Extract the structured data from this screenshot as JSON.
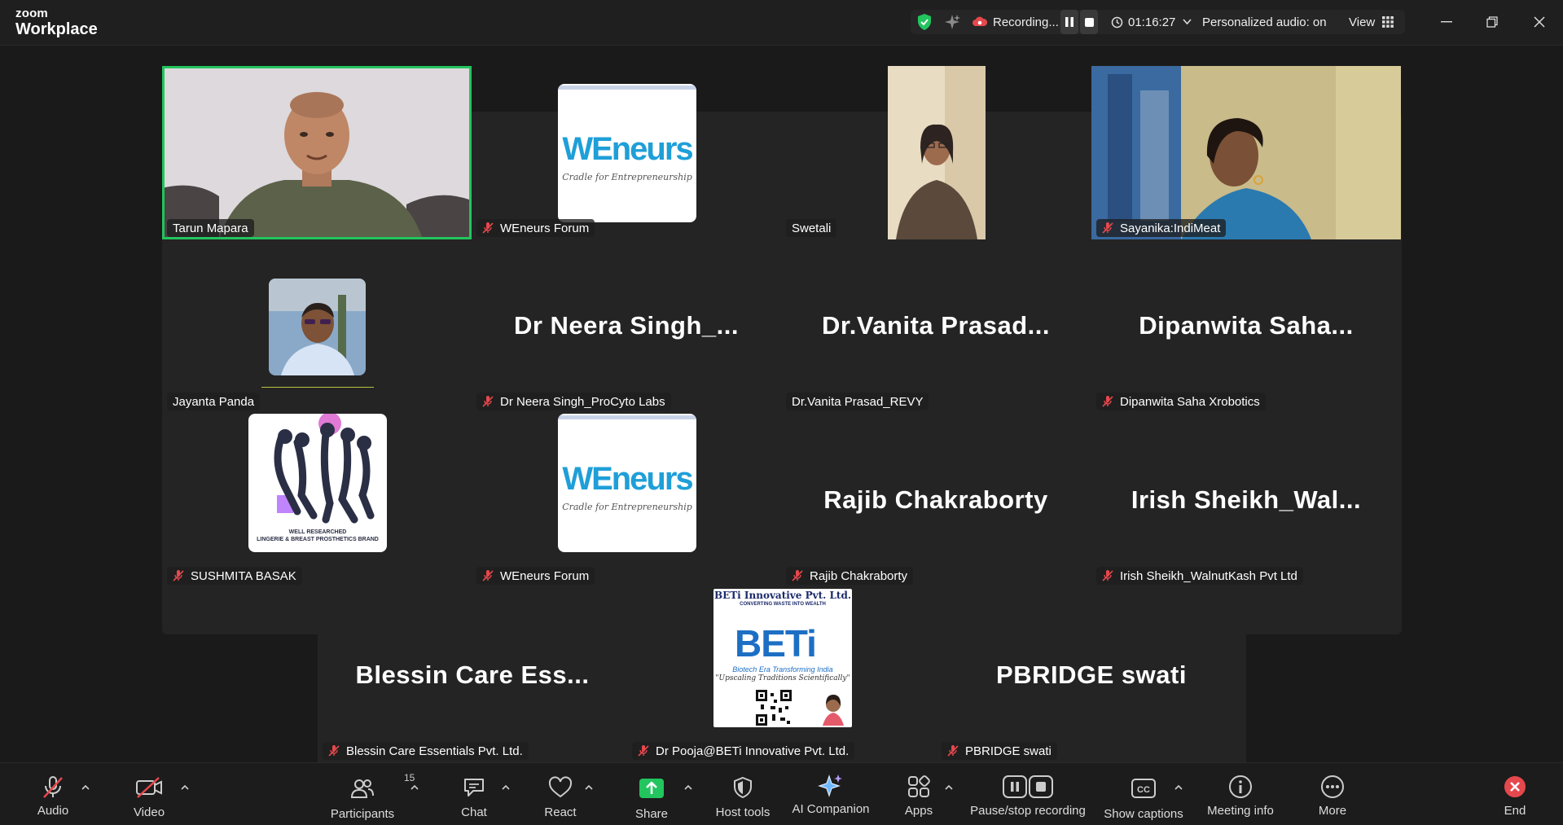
{
  "app": {
    "brand_top": "zoom",
    "brand_bottom": "Workplace"
  },
  "status_bar": {
    "recording_label": "Recording...",
    "timer": "01:16:27",
    "audio_label": "Personalized audio: on",
    "view_label": "View"
  },
  "colors": {
    "accent_green": "#22c55e",
    "mute_red": "#e5484d",
    "share_green": "#22c55e"
  },
  "participants": [
    {
      "name": "Tarun Mapara",
      "muted": false,
      "video": true,
      "active_speaker": true
    },
    {
      "name": "WEneurs Forum",
      "muted": true,
      "logo": "weneurs-logo",
      "logo_title": "WEneurs",
      "logo_tagline": "Cradle for Entrepreneurship"
    },
    {
      "name": "Swetali",
      "muted": false,
      "video": true
    },
    {
      "name": "Sayanika:IndiMeat",
      "muted": true,
      "video": true
    },
    {
      "name": "Jayanta Panda",
      "muted": false,
      "avatar": "photo"
    },
    {
      "name": "Dr Neera Singh_ProCyto Labs",
      "display": "Dr  Neera  Singh_...",
      "muted": true
    },
    {
      "name": "Dr.Vanita Prasad_REVY",
      "display": "Dr.Vanita  Prasad...",
      "muted": false
    },
    {
      "name": "Dipanwita Saha Xrobotics",
      "display": "Dipanwita  Saha...",
      "muted": true
    },
    {
      "name": "SUSHMITA BASAK",
      "muted": true,
      "logo": "lingerie-logo",
      "logo_caption1": "WELL RESEARCHED",
      "logo_caption2": "LINGERIE & BREAST PROSTHETICS BRAND"
    },
    {
      "name": "WEneurs Forum",
      "muted": true,
      "logo": "weneurs-logo",
      "logo_title": "WEneurs",
      "logo_tagline": "Cradle for Entrepreneurship"
    },
    {
      "name": "Rajib Chakraborty",
      "display": "Rajib  Chakraborty",
      "muted": true
    },
    {
      "name": "Irish Sheikh_WalnutKash Pvt Ltd",
      "display": "Irish  Sheikh_Wal...",
      "muted": true
    },
    {
      "name": "Blessin Care Essentials Pvt. Ltd.",
      "display": "Blessin  Care  Ess...",
      "muted": true
    },
    {
      "name": "Dr Pooja@BETi Innovative Pvt. Ltd.",
      "muted": true,
      "logo": "beti-logo",
      "logo_company": "BETi Innovative Pvt. Ltd.",
      "logo_slogan": "CONVERTING WASTE INTO WEALTH",
      "logo_title": "BETi",
      "logo_sub": "Biotech Era Transforming India",
      "logo_motto": "\"Upscaling Traditions Scientifically\""
    },
    {
      "name": "PBRIDGE swati",
      "display": "PBRIDGE  swati",
      "muted": true
    }
  ],
  "toolbar": {
    "audio": "Audio",
    "video": "Video",
    "participants": "Participants",
    "participants_count": "15",
    "chat": "Chat",
    "react": "React",
    "share": "Share",
    "host_tools": "Host tools",
    "ai_companion": "AI Companion",
    "apps": "Apps",
    "pause_stop": "Pause/stop recording",
    "captions": "Show captions",
    "meeting_info": "Meeting info",
    "more": "More",
    "end": "End"
  }
}
